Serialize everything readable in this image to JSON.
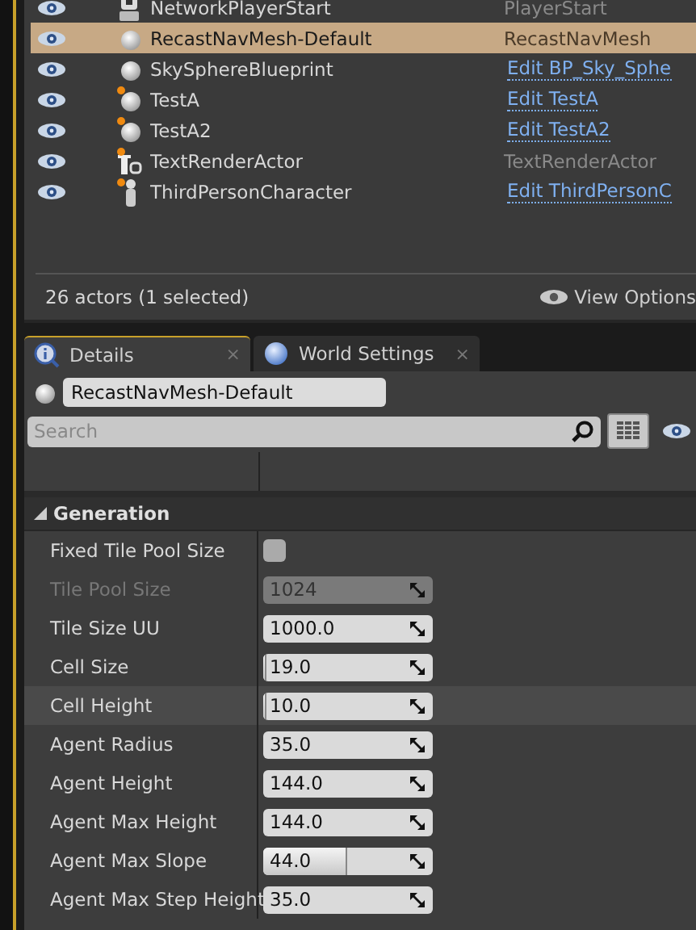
{
  "outliner": {
    "rows": [
      {
        "visible": true,
        "kind": "player-start",
        "dot": false,
        "label": "NetworkPlayerStart",
        "type": {
          "kind": "plain",
          "text": "PlayerStart"
        },
        "selected": false
      },
      {
        "visible": true,
        "kind": "sphere",
        "dot": false,
        "label": "RecastNavMesh-Default",
        "type": {
          "kind": "plain",
          "text": "RecastNavMesh"
        },
        "selected": true
      },
      {
        "visible": true,
        "kind": "sphere",
        "dot": false,
        "label": "SkySphereBlueprint",
        "type": {
          "kind": "link",
          "text": "Edit BP_Sky_Sphe"
        },
        "selected": false
      },
      {
        "visible": true,
        "kind": "sphere",
        "dot": true,
        "label": "TestA",
        "type": {
          "kind": "link",
          "text": "Edit TestA"
        },
        "selected": false
      },
      {
        "visible": true,
        "kind": "sphere",
        "dot": true,
        "label": "TestA2",
        "type": {
          "kind": "link",
          "text": "Edit TestA2"
        },
        "selected": false
      },
      {
        "visible": true,
        "kind": "text",
        "dot": true,
        "label": "TextRenderActor",
        "type": {
          "kind": "plain",
          "text": "TextRenderActor"
        },
        "selected": false
      },
      {
        "visible": true,
        "kind": "person",
        "dot": true,
        "label": "ThirdPersonCharacter",
        "type": {
          "kind": "link",
          "text": "Edit ThirdPersonC"
        },
        "selected": false
      }
    ],
    "status": "26 actors (1 selected)",
    "view_options": "View Options"
  },
  "tabs": [
    {
      "label": "Details",
      "kind": "details",
      "close": "×",
      "selected": true
    },
    {
      "label": "World Settings",
      "kind": "world",
      "close": "×",
      "selected": false
    }
  ],
  "details": {
    "object_name": "RecastNavMesh-Default",
    "search": {
      "placeholder": "Search"
    },
    "section": {
      "title": "Generation",
      "expanded": true
    },
    "properties": [
      {
        "label": "Fixed Tile Pool Size",
        "kind": "checkbox",
        "checked": false,
        "disabled": false,
        "hovered": false
      },
      {
        "label": "Tile Pool Size",
        "kind": "number",
        "value": "1024",
        "disabled": true,
        "hovered": false
      },
      {
        "label": "Tile Size UU",
        "kind": "number",
        "value": "1000.0",
        "disabled": false,
        "hovered": false
      },
      {
        "label": "Cell Size",
        "kind": "slider",
        "value": "19.0",
        "level": 0.01,
        "disabled": false,
        "hovered": false
      },
      {
        "label": "Cell Height",
        "kind": "slider",
        "value": "10.0",
        "level": 0.01,
        "disabled": false,
        "hovered": true
      },
      {
        "label": "Agent Radius",
        "kind": "number",
        "value": "35.0",
        "disabled": false,
        "hovered": false
      },
      {
        "label": "Agent Height",
        "kind": "number",
        "value": "144.0",
        "disabled": false,
        "hovered": false
      },
      {
        "label": "Agent Max Height",
        "kind": "number",
        "value": "144.0",
        "disabled": false,
        "hovered": false
      },
      {
        "label": "Agent Max Slope",
        "kind": "slider",
        "value": "44.0",
        "level": 0.49,
        "disabled": false,
        "hovered": false
      },
      {
        "label": "Agent Max Step Height",
        "kind": "number",
        "value": "35.0",
        "disabled": false,
        "hovered": false
      }
    ]
  }
}
